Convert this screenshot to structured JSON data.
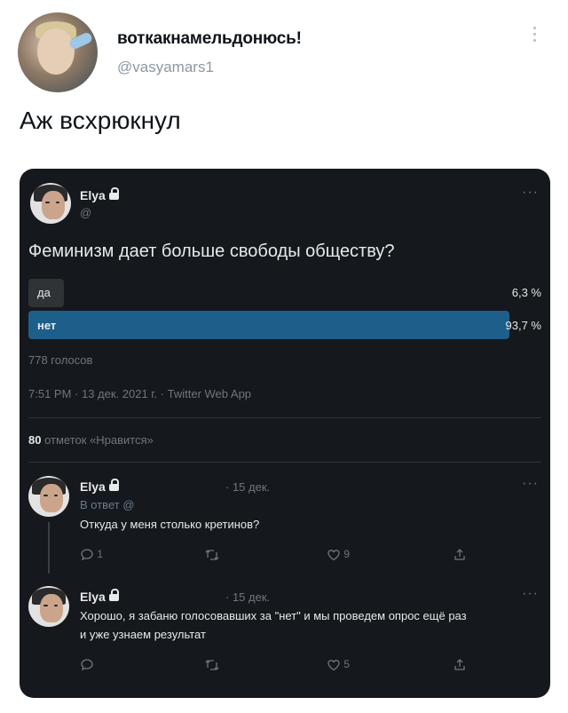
{
  "post": {
    "display_name": "воткакнамельдонюсь!",
    "handle": "@vasyamars1",
    "text": "Аж всхрюкнул"
  },
  "embedded": {
    "author": "Elya",
    "handle_line": "@",
    "more": "···",
    "question": "Феминизм дает больше свободы обществу?",
    "poll": [
      {
        "label": "да",
        "percent": "6,3 %",
        "share": 0.063
      },
      {
        "label": "нет",
        "percent": "93,7 %",
        "share": 0.937
      }
    ],
    "votes": "778 голосов",
    "timestamp": "7:51 PM · 13 дек. 2021 г. · Twitter Web App",
    "likes_count": "80",
    "likes_label": "отметок «Нравится»",
    "replies": [
      {
        "author": "Elya",
        "date": "· 15 дек.",
        "reply_to": "В ответ @",
        "text": "Откуда у меня столько кретинов?",
        "text2": "",
        "comments": "1",
        "retweets": "",
        "likes": "9"
      },
      {
        "author": "Elya",
        "date": "· 15 дек.",
        "reply_to": "",
        "text": "Хорошо, я забаню голосовавших за \"нет\" и мы проведем опрос ещё раз",
        "text2": "и уже узнаем результат",
        "comments": "",
        "retweets": "",
        "likes": "5"
      }
    ]
  },
  "colors": {
    "card_bg": "#15181c",
    "bar_winner": "#1d5f8a",
    "bar_other": "#2f3336"
  }
}
